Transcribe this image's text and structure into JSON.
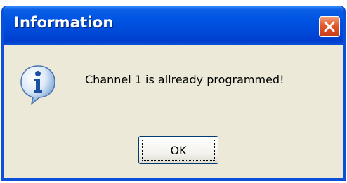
{
  "window": {
    "title": "Information",
    "close_icon": "close-icon"
  },
  "message": {
    "icon": "info-icon",
    "text": "Channel 1 is allready programmed!"
  },
  "buttons": {
    "ok_label": "OK"
  },
  "colors": {
    "titlebar": "#0054e3",
    "frame": "#0a50d8",
    "client_area": "#ece9d8",
    "close_button": "#e2572b"
  }
}
